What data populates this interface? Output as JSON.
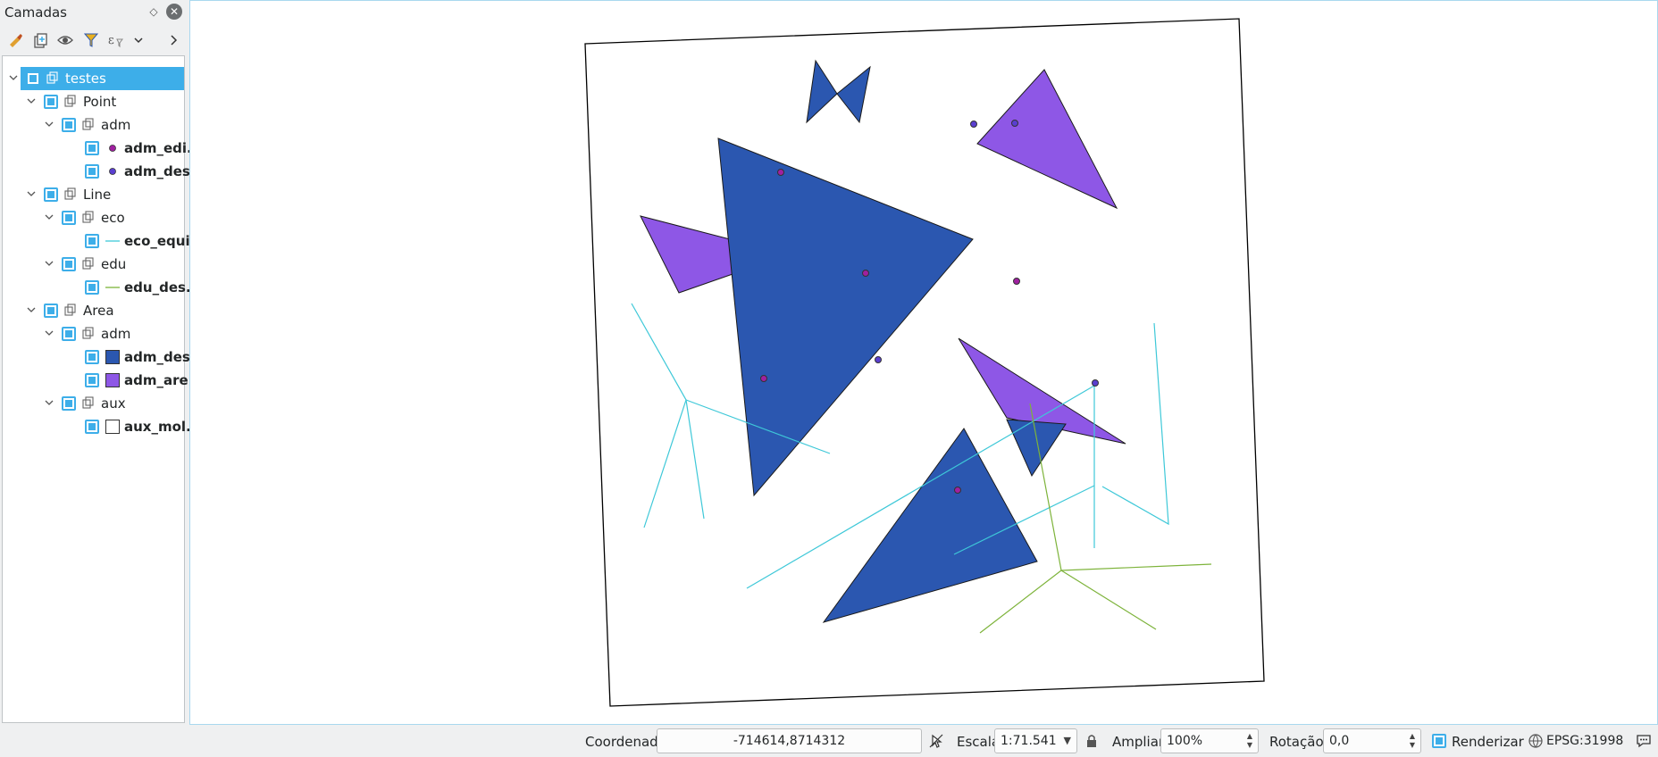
{
  "panel": {
    "title": "Camadas",
    "toolbar_icons": [
      "style-manager-icon",
      "add-group-icon",
      "visibility-icon",
      "filter-legend-icon",
      "expression-filter-icon",
      "chevron-down-icon",
      "chevron-right-icon"
    ],
    "tree": [
      {
        "id": "testes",
        "label": "testes",
        "level": 0,
        "type": "group",
        "selected": true
      },
      {
        "id": "point",
        "label": "Point",
        "level": 1,
        "type": "group"
      },
      {
        "id": "point-adm",
        "label": "adm",
        "level": 2,
        "type": "group"
      },
      {
        "id": "adm-edi",
        "label": "adm_edi...",
        "level": 3,
        "type": "layer",
        "symbol": "point",
        "color": "#a020a0"
      },
      {
        "id": "adm-des-pt",
        "label": "adm_des...",
        "level": 3,
        "type": "layer",
        "symbol": "point",
        "color": "#5a3fd0"
      },
      {
        "id": "line",
        "label": "Line",
        "level": 1,
        "type": "group"
      },
      {
        "id": "line-eco",
        "label": "eco",
        "level": 2,
        "type": "group"
      },
      {
        "id": "eco-equi",
        "label": "eco_equi...",
        "level": 3,
        "type": "layer",
        "symbol": "line",
        "color": "#3ec8d8"
      },
      {
        "id": "line-edu",
        "label": "edu",
        "level": 2,
        "type": "group"
      },
      {
        "id": "edu-des",
        "label": "edu_des...",
        "level": 3,
        "type": "layer",
        "symbol": "line",
        "color": "#7db33a"
      },
      {
        "id": "area",
        "label": "Area",
        "level": 1,
        "type": "group"
      },
      {
        "id": "area-adm",
        "label": "adm",
        "level": 2,
        "type": "group"
      },
      {
        "id": "adm-des-poly",
        "label": "adm_des...",
        "level": 3,
        "type": "layer",
        "symbol": "fill",
        "color": "#2b57b0"
      },
      {
        "id": "adm-are",
        "label": "adm_are...",
        "level": 3,
        "type": "layer",
        "symbol": "fill",
        "color": "#8e57e6"
      },
      {
        "id": "area-aux",
        "label": "aux",
        "level": 2,
        "type": "group"
      },
      {
        "id": "aux-mol",
        "label": "aux_mol...",
        "level": 3,
        "type": "layer",
        "symbol": "fill",
        "color": "#ffffff"
      }
    ]
  },
  "colors": {
    "accent": "#3daee9",
    "poly_blue": "#2b57b0",
    "poly_purple": "#8e57e6",
    "line_cyan": "#3ec8d8",
    "line_green": "#7db33a",
    "point_magenta": "#a020a0",
    "point_blue": "#5a3fd0"
  },
  "status": {
    "coord_label": "Coordenada",
    "coord_value": "-714614,8714312",
    "scale_label": "Escala",
    "scale_value": "1:71.541",
    "zoom_label": "Ampliar",
    "zoom_value": "100%",
    "rotation_label": "Rotação",
    "rotation_value": "0,0",
    "render_label": "Renderizar",
    "crs_label": "EPSG:31998"
  }
}
